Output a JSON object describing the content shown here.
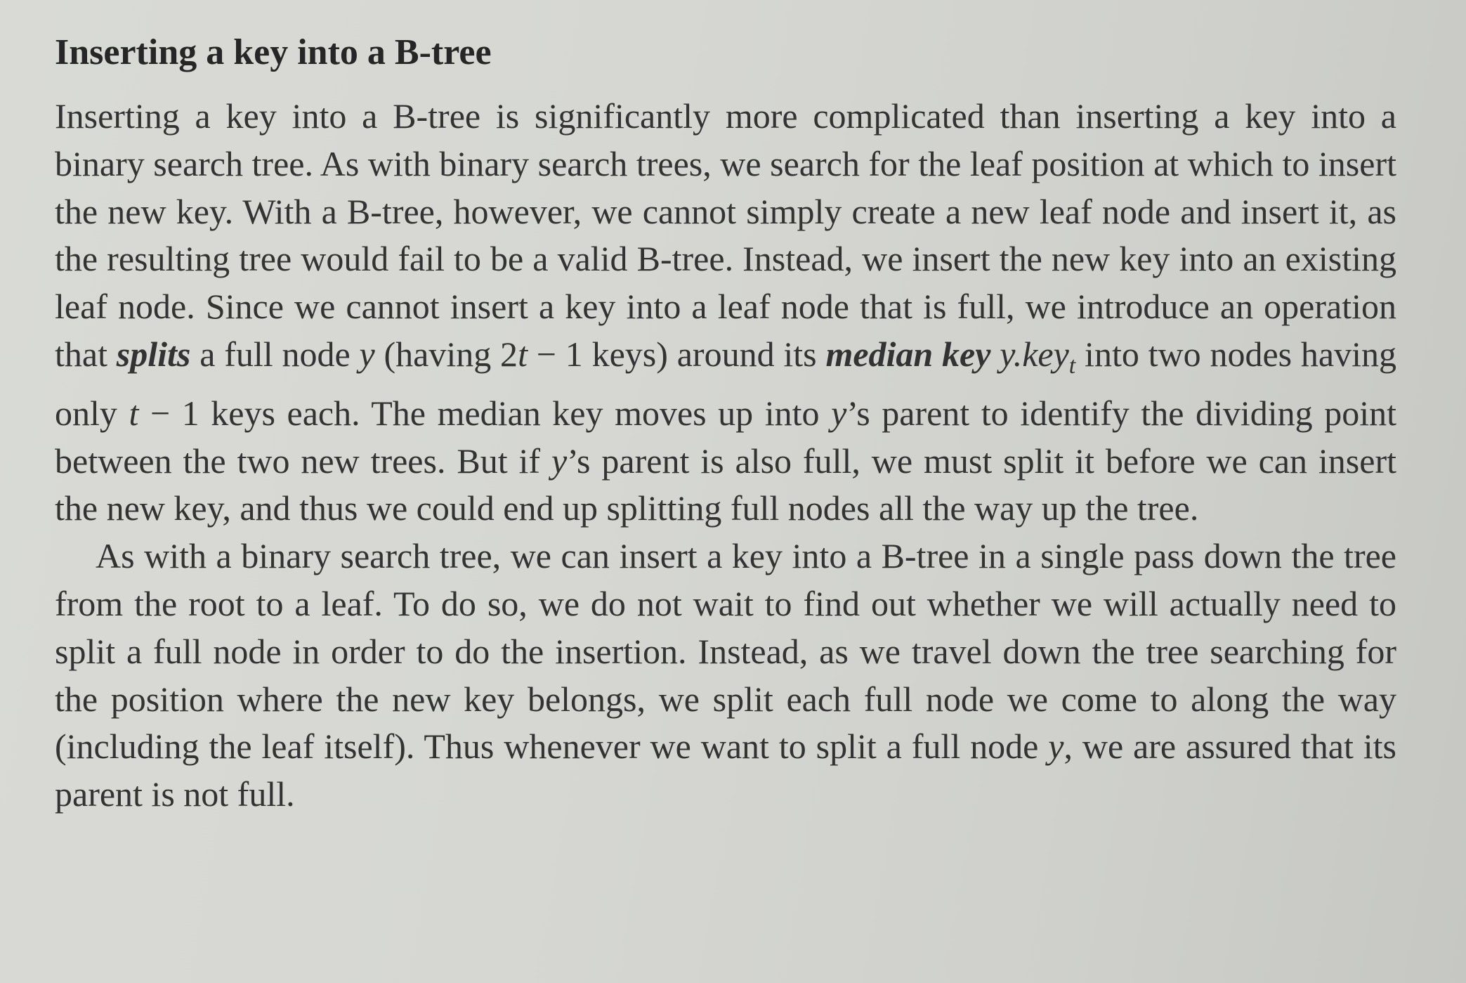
{
  "section": {
    "title": "Inserting a key into a B-tree"
  },
  "paragraph1": {
    "s1": "Inserting a key into a B-tree is significantly more complicated than inserting a key into a binary search tree. As with binary search trees, we search for the leaf position at which to insert the new key. With a B-tree, however, we cannot simply create a new leaf node and insert it, as the resulting tree would fail to be a valid B-tree. Instead, we insert the new key into an existing leaf node. Since we cannot insert a key into a leaf node that is full, we introduce an operation that ",
    "splits": "splits",
    "s2": " a full node ",
    "y1": "y",
    "s3": " (having 2",
    "t1": "t",
    "s4": " − 1 keys) around its ",
    "median_key": "median key",
    "s5": " ",
    "y_key": "y.key",
    "key_sub": "t",
    "s6": " into two nodes having only ",
    "t2": "t",
    "s7": " − 1 keys each. The median key moves up into ",
    "y2": "y",
    "s8": "’s parent to identify the dividing point between the two new trees. But if ",
    "y3": "y",
    "s9": "’s parent is also full, we must split it before we can insert the new key, and thus we could end up splitting full nodes all the way up the tree."
  },
  "paragraph2": {
    "s1": "As with a binary search tree, we can insert a key into a B-tree in a single pass down the tree from the root to a leaf. To do so, we do not wait to find out whether we will actually need to split a full node in order to do the insertion. Instead, as we travel down the tree searching for the position where the new key belongs, we split each full node we come to along the way (including the leaf itself). Thus whenever we want to split a full node ",
    "y": "y",
    "s2": ", we are assured that its parent is not full."
  }
}
